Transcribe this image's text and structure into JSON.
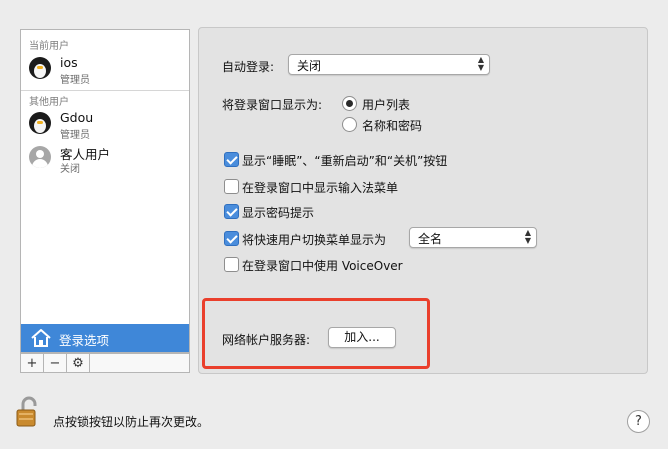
{
  "users": {
    "current_header": "当前用户",
    "current": {
      "name": "ios",
      "role": "管理员",
      "icon": "penguin-avatar-icon"
    },
    "others_header": "其他用户",
    "others": [
      {
        "name": "Gdou",
        "role": "管理员",
        "icon": "penguin-avatar-icon"
      },
      {
        "name": "客人用户",
        "role": "关闭",
        "icon": "guest-avatar-icon"
      }
    ],
    "login_options_label": "登录选项"
  },
  "toolbar": {
    "add": "+",
    "remove": "−",
    "gear": "⚙"
  },
  "settings": {
    "auto_login": {
      "label": "自动登录:",
      "value": "关闭"
    },
    "display_window": {
      "label": "将登录窗口显示为:",
      "options": [
        {
          "label": "用户列表",
          "selected": true
        },
        {
          "label": "名称和密码",
          "selected": false
        }
      ]
    },
    "checkboxes": [
      {
        "label": "显示“睡眠”、“重新启动”和“关机”按钮",
        "checked": true
      },
      {
        "label": "在登录窗口中显示输入法菜单",
        "checked": false
      },
      {
        "label": "显示密码提示",
        "checked": true
      },
      {
        "label": "将快速用户切换菜单显示为",
        "checked": true
      },
      {
        "label": "在登录窗口中使用 VoiceOver",
        "checked": false
      }
    ],
    "fast_user_switch_value": "全名",
    "network_server": {
      "label": "网络帐户服务器:",
      "button": "加入..."
    }
  },
  "footer": {
    "lock_text": "点按锁按钮以防止再次更改。",
    "help": "?"
  },
  "colors": {
    "accent": "#3f87d8",
    "highlight": "#ea3f2c"
  }
}
